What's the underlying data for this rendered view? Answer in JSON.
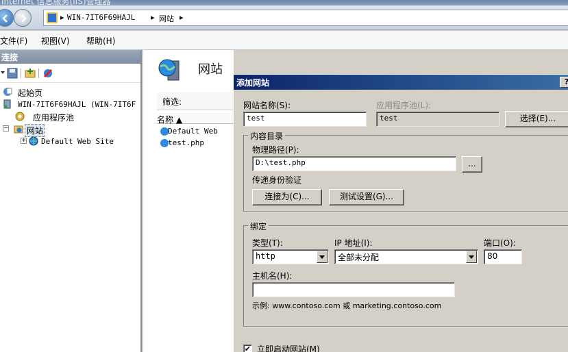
{
  "window": {
    "title": "Internet 信息服务(IIS)管理器"
  },
  "address": {
    "crumbs": [
      "WIN-7IT6F69HAJL",
      "网站"
    ],
    "sep": "▸"
  },
  "menu": {
    "items": [
      "文件(F)",
      "视图(V)",
      "帮助(H)"
    ]
  },
  "connections": {
    "header": "连接",
    "tree": {
      "start_page": "起始页",
      "server": "WIN-7IT6F69HAJL (WIN-7IT6F",
      "app_pools": "应用程序池",
      "sites": "网站",
      "site_default": "Default Web Site"
    }
  },
  "main": {
    "title": "网站",
    "filter_label": "筛选:",
    "column_name": "名称 ▲",
    "rows": [
      "Default Web",
      "test.php"
    ]
  },
  "dialog": {
    "title": "添加网站",
    "help": "?",
    "site_name_label": "网站名称(S):",
    "site_name_value": "test",
    "app_pool_label": "应用程序池(L):",
    "app_pool_value": "test",
    "select_button": "选择(E)...",
    "content": {
      "group_title": "内容目录",
      "physical_path_label": "物理路径(P):",
      "physical_path_value": "D:\\test.php",
      "browse_button": "...",
      "passthrough_label": "传递身份验证",
      "connect_as_button": "连接为(C)...",
      "test_settings_button": "测试设置(G)..."
    },
    "binding": {
      "group_title": "绑定",
      "type_label": "类型(T):",
      "type_value": "http",
      "ip_label": "IP 地址(I):",
      "ip_value": "全部未分配",
      "port_label": "端口(O):",
      "port_value": "80",
      "host_label": "主机名(H):",
      "host_value": "",
      "example": "示例: www.contoso.com 或 marketing.contoso.com"
    },
    "start_immediately": {
      "label": "立即启动网站(M)",
      "checked": true,
      "mark": "✔"
    }
  }
}
